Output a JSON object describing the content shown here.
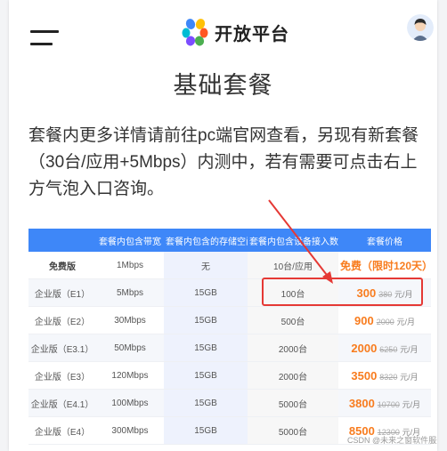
{
  "header": {
    "brand_text": "开放平台",
    "menu_icon": "hamburger-menu-icon",
    "logo_icon": "flower-logo-icon",
    "avatar_icon": "user-avatar"
  },
  "page": {
    "title": "基础套餐",
    "intro": "套餐内更多详情请前往pc端官网查看，另现有新套餐（30台/应用+5Mbps）内测中，若有需要可点击右上方气泡入口咨询。"
  },
  "table": {
    "columns": [
      "",
      "套餐内包含带宽",
      "套餐内包含的存储空间",
      "套餐内包含设备接入数",
      "套餐价格"
    ],
    "rows": [
      {
        "name": "免费版",
        "bandwidth": "1Mbps",
        "storage": "无",
        "devices": "10台/应用",
        "free_label": "免费（限时120天）"
      },
      {
        "name": "企业版（E1）",
        "bandwidth": "5Mbps",
        "storage": "15GB",
        "devices": "100台",
        "price": "300",
        "old_price": "380",
        "unit": "元/月"
      },
      {
        "name": "企业版（E2）",
        "bandwidth": "30Mbps",
        "storage": "15GB",
        "devices": "500台",
        "price": "900",
        "old_price": "2000",
        "unit": "元/月"
      },
      {
        "name": "企业版（E3.1）",
        "bandwidth": "50Mbps",
        "storage": "15GB",
        "devices": "2000台",
        "price": "2000",
        "old_price": "6250",
        "unit": "元/月"
      },
      {
        "name": "企业版（E3）",
        "bandwidth": "120Mbps",
        "storage": "15GB",
        "devices": "2000台",
        "price": "3500",
        "old_price": "8320",
        "unit": "元/月"
      },
      {
        "name": "企业版（E4.1）",
        "bandwidth": "100Mbps",
        "storage": "15GB",
        "devices": "5000台",
        "price": "3800",
        "old_price": "10700",
        "unit": "元/月"
      },
      {
        "name": "企业版（E4）",
        "bandwidth": "300Mbps",
        "storage": "15GB",
        "devices": "5000台",
        "price": "8500",
        "old_price": "12300",
        "unit": "元/月"
      }
    ]
  },
  "watermark": "CSDN @未来之窗软件服务",
  "colors": {
    "header_blue": "#3e87f8",
    "price_orange": "#f87c1e",
    "highlight_red": "#e53935"
  }
}
